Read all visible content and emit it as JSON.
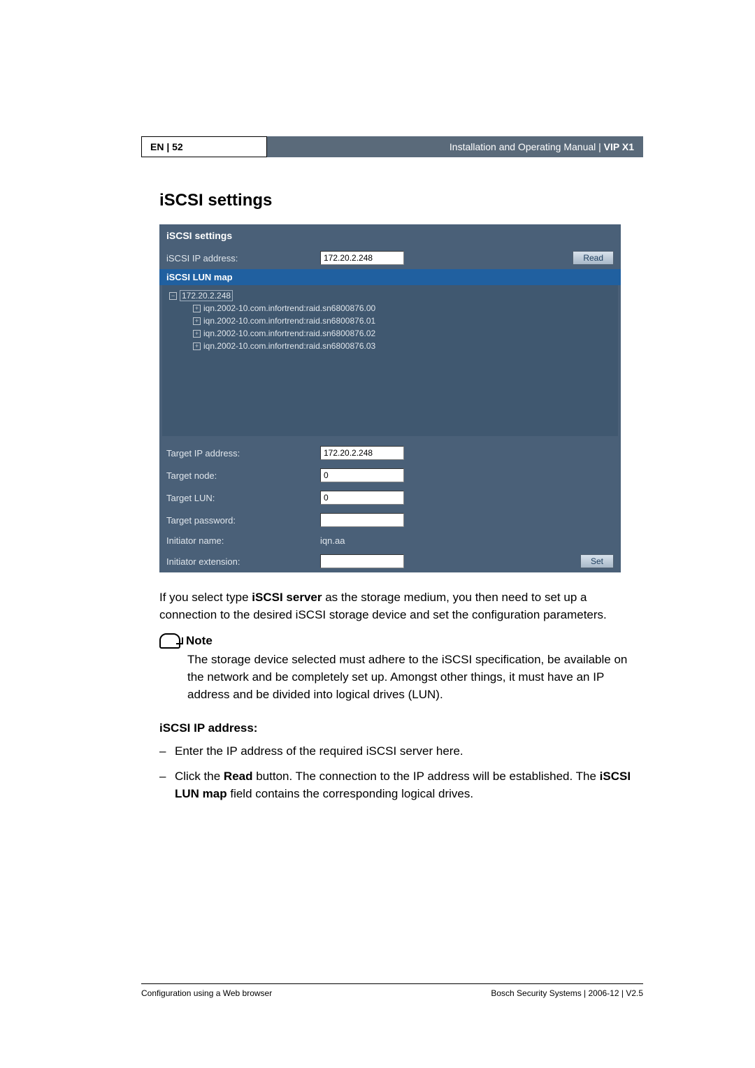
{
  "header": {
    "left": "EN | 52",
    "right_prefix": "Installation and Operating Manual | ",
    "right_product": "VIP X1"
  },
  "title": "iSCSI settings",
  "panel": {
    "heading": "iSCSI settings",
    "iscsi_ip_label": "iSCSI IP address:",
    "iscsi_ip_value": "172.20.2.248",
    "read_btn": "Read",
    "lun_map_heading": "iSCSI LUN map",
    "tree_root": "172.20.2.248",
    "tree_items": [
      "iqn.2002-10.com.infortrend:raid.sn6800876.00",
      "iqn.2002-10.com.infortrend:raid.sn6800876.01",
      "iqn.2002-10.com.infortrend:raid.sn6800876.02",
      "iqn.2002-10.com.infortrend:raid.sn6800876.03"
    ],
    "target_ip_label": "Target IP address:",
    "target_ip_value": "172.20.2.248",
    "target_node_label": "Target node:",
    "target_node_value": "0",
    "target_lun_label": "Target LUN:",
    "target_lun_value": "0",
    "target_password_label": "Target password:",
    "target_password_value": "",
    "initiator_name_label": "Initiator name:",
    "initiator_name_value": "iqn.aa",
    "initiator_ext_label": "Initiator extension:",
    "initiator_ext_value": "",
    "set_btn": "Set"
  },
  "intro": {
    "pre": "If you select type ",
    "bold": "iSCSI server",
    "post": " as the storage medium, you then need to set up a connection to the desired iSCSI storage device and set the configuration parameters."
  },
  "note": {
    "heading": "Note",
    "body": "The storage device selected must adhere to the iSCSI specification, be available on the network and be completely set up. Amongst other things, it must have an IP address and be divided into logical drives (LUN)."
  },
  "ip_section": {
    "heading": "iSCSI IP address:",
    "item1": "Enter the IP address of the required iSCSI server here.",
    "item2_pre": "Click the ",
    "item2_b1": "Read",
    "item2_mid": " button. The connection to the IP address will be established. The ",
    "item2_b2": "iSCSI LUN map",
    "item2_post": " field contains the corresponding logical drives."
  },
  "footer": {
    "left": "Configuration using a Web browser",
    "right": "Bosch Security Systems | 2006-12 | V2.5"
  }
}
